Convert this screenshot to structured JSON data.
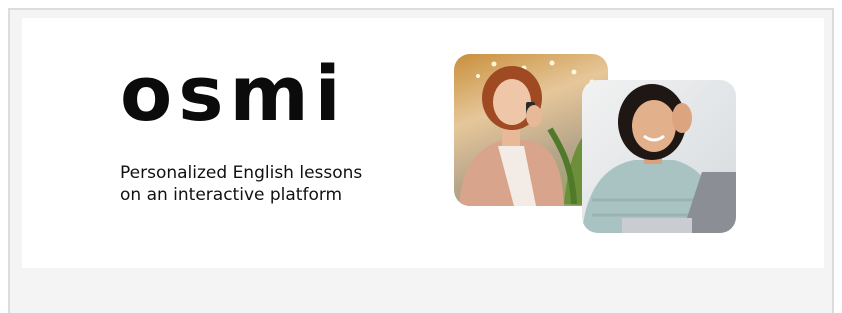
{
  "brand": {
    "logo_text": "osmi",
    "tagline_line1": "Personalized English lessons",
    "tagline_line2": "on an interactive platform"
  },
  "images": {
    "back": "photo-woman-on-phone",
    "front": "photo-woman-with-laptop"
  },
  "colors": {
    "text": "#0b0b0b",
    "banner_bg": "#ffffff",
    "frame_bg": "#f4f4f4",
    "frame_border": "#dcdcdc"
  }
}
